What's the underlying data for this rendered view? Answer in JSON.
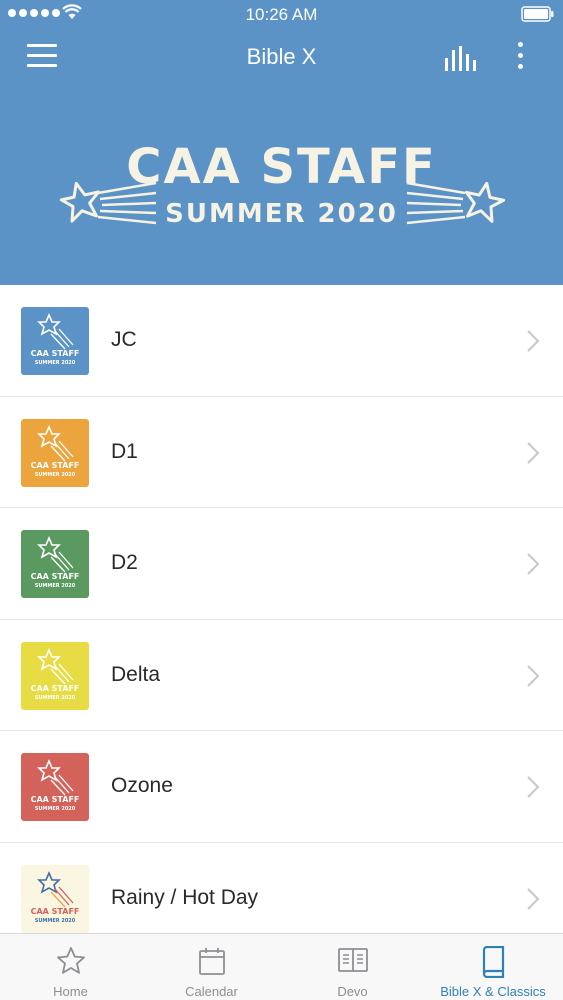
{
  "status_bar": {
    "time": "10:26 AM"
  },
  "app_bar": {
    "title": "Bible X"
  },
  "banner": {
    "line1": "CAA STAFF",
    "line2": "SUMMER 2020"
  },
  "colors": {
    "header": "#5b93c6",
    "accent": "#2f80b9",
    "banner_text": "#f6f2e4"
  },
  "list": {
    "items": [
      {
        "label": "JC",
        "thumb_color": "#5b93c6",
        "thumb_text1": "CAA STAFF",
        "thumb_text2": "SUMMER 2020"
      },
      {
        "label": "D1",
        "thumb_color": "#eba53c",
        "thumb_text1": "CAA STAFF",
        "thumb_text2": "SUMMER 2020"
      },
      {
        "label": "D2",
        "thumb_color": "#5a9a60",
        "thumb_text1": "CAA STAFF",
        "thumb_text2": "SUMMER 2020"
      },
      {
        "label": "Delta",
        "thumb_color": "#e8dc45",
        "thumb_text1": "CAA STAFF",
        "thumb_text2": "SUMMER 2020"
      },
      {
        "label": "Ozone",
        "thumb_color": "#d2625a",
        "thumb_text1": "CAA STAFF",
        "thumb_text2": "SUMMER 2020"
      },
      {
        "label": "Rainy / Hot Day",
        "thumb_color": "#fbf6e2",
        "thumb_text1": "CAA STAFF",
        "thumb_text2": "SUMMER 2020"
      }
    ]
  },
  "tab_bar": {
    "tabs": [
      {
        "label": "Home",
        "icon": "star-icon"
      },
      {
        "label": "Calendar",
        "icon": "calendar-icon"
      },
      {
        "label": "Devo",
        "icon": "open-book-icon"
      },
      {
        "label": "Bible X & Classics",
        "icon": "book-icon",
        "active": true
      }
    ]
  }
}
